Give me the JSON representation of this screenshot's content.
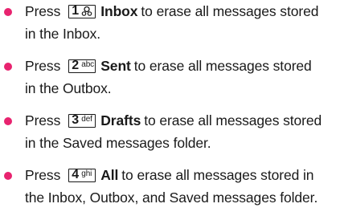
{
  "items": [
    {
      "lead": "Press",
      "key": {
        "number": "1",
        "sub": "",
        "icon": "voicemail-icon"
      },
      "label": "Inbox",
      "line1_rest": "to erase all messages stored",
      "line2": "in the Inbox."
    },
    {
      "lead": "Press",
      "key": {
        "number": "2",
        "sub": "abc",
        "icon": ""
      },
      "label": "Sent",
      "line1_rest": "to erase all messages stored",
      "line2": "in the Outbox."
    },
    {
      "lead": "Press",
      "key": {
        "number": "3",
        "sub": "def",
        "icon": ""
      },
      "label": "Drafts",
      "line1_rest": "to erase all messages stored",
      "line2": "in the Saved messages folder."
    },
    {
      "lead": "Press",
      "key": {
        "number": "4",
        "sub": "ghi",
        "icon": ""
      },
      "label": "All",
      "line1_rest": "to erase all messages stored in",
      "line2": "the Inbox, Outbox, and Saved messages folder."
    }
  ],
  "colors": {
    "bullet": "#e8236f",
    "text": "#1a1a1a"
  }
}
